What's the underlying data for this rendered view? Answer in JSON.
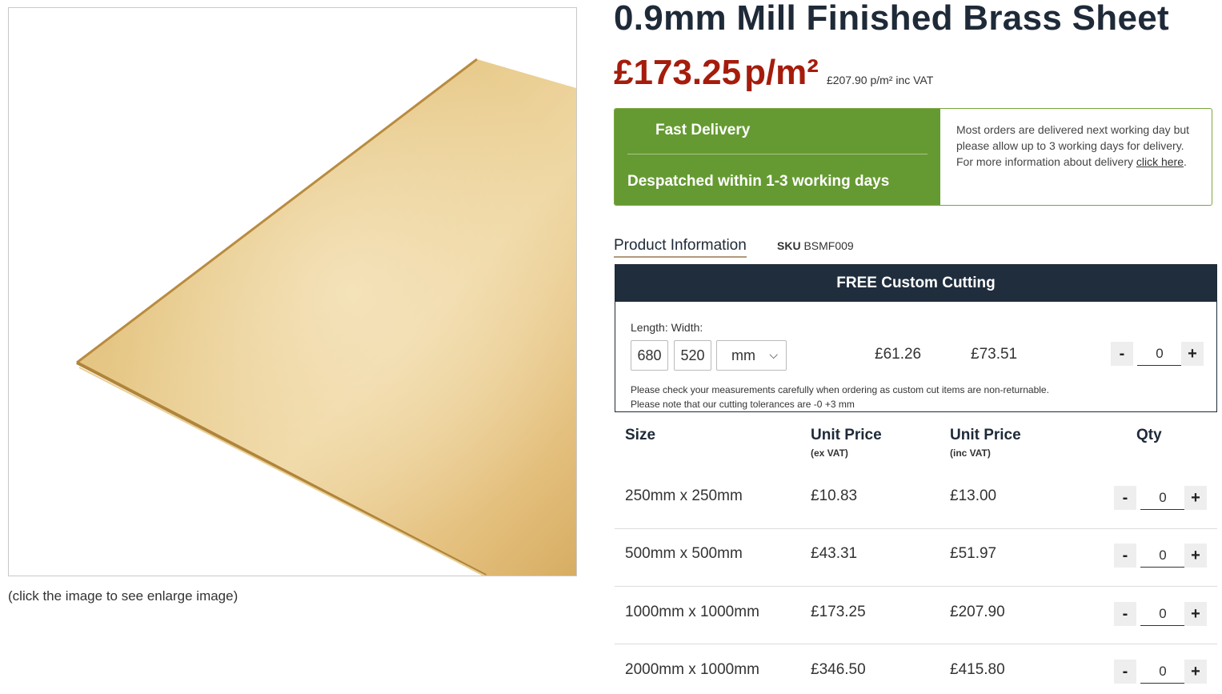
{
  "product": {
    "title": "0.9mm Mill Finished Brass Sheet",
    "price": "£173.25",
    "price_unit": "p/m²",
    "price_inc_vat": "£207.90 p/m² inc VAT",
    "image_caption": "(click the image to see enlarge image)"
  },
  "delivery": {
    "title": "Fast Delivery",
    "subtitle": "Despatched within 1-3 working days",
    "info_text": "Most orders are delivered next working day but please allow up to 3 working days for delivery. For more information about delivery ",
    "link_text": "click here",
    "info_end": "."
  },
  "tabs": {
    "product_info": "Product Information",
    "sku_label": "SKU",
    "sku_value": "BSMF009"
  },
  "custom_cutting": {
    "header": "FREE Custom Cutting",
    "length_label": "Length:",
    "width_label": "Width:",
    "length_value": "680",
    "width_value": "520",
    "unit": "mm",
    "price_ex": "£61.26",
    "price_inc": "£73.51",
    "qty": "0",
    "note1": "Please check your measurements carefully when ordering as custom cut items are non-returnable.",
    "note2": "Please note that our cutting tolerances are -0 +3 mm"
  },
  "table": {
    "headers": {
      "size": "Size",
      "unit_price": "Unit Price",
      "ex_vat": "(ex VAT)",
      "unit_price_inc": "Unit Price",
      "inc_vat": "(inc VAT)",
      "qty": "Qty"
    },
    "rows": [
      {
        "size": "250mm x 250mm",
        "ex": "£10.83",
        "inc": "£13.00",
        "qty": "0"
      },
      {
        "size": "500mm x 500mm",
        "ex": "£43.31",
        "inc": "£51.97",
        "qty": "0"
      },
      {
        "size": "1000mm x 1000mm",
        "ex": "£173.25",
        "inc": "£207.90",
        "qty": "0"
      },
      {
        "size": "2000mm x 1000mm",
        "ex": "£346.50",
        "inc": "£415.80",
        "qty": "0"
      }
    ],
    "minus": "-",
    "plus": "+"
  },
  "colors": {
    "price_red": "#a51c0c",
    "delivery_green": "#659a32",
    "navy": "#1f2d3d"
  }
}
